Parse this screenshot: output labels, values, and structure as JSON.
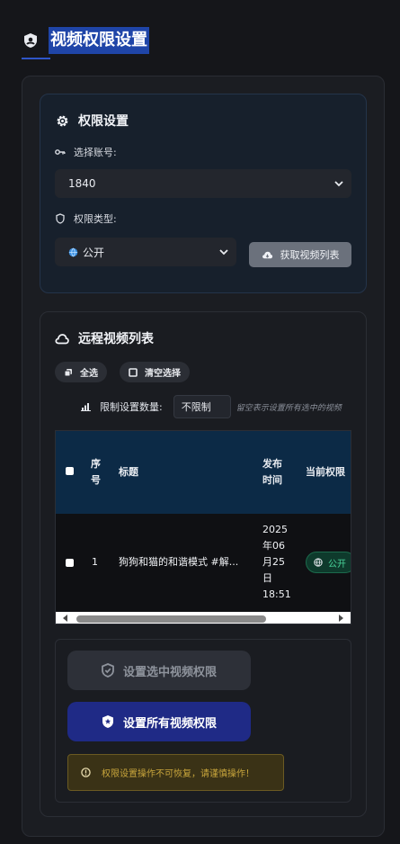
{
  "header": {
    "title": "视频权限设置",
    "icon": "shield-user-icon"
  },
  "settings": {
    "title": "权限设置",
    "account_label": "选择账号:",
    "account_value": "1840",
    "perm_type_label": "权限类型:",
    "perm_type_value": "公开",
    "fetch_button": "获取视频列表"
  },
  "video_list": {
    "title": "远程视频列表",
    "select_all": "全选",
    "clear_selection": "清空选择",
    "limit_label": "限制设置数量:",
    "limit_value": "不限制",
    "limit_hint": "留空表示设置所有选中的视频",
    "columns": [
      "序号",
      "标题",
      "发布时间",
      "当前权限"
    ],
    "columns_display": {
      "index": [
        "序",
        "号"
      ],
      "title": "标题",
      "time": [
        "发布",
        "时间"
      ],
      "perm": "当前权限"
    },
    "rows": [
      {
        "index": "1",
        "title": "狗狗和猫的和谐模式 #解...",
        "time_lines": [
          "2025",
          "年06",
          "月25",
          "日",
          "18:51"
        ],
        "permission": "公开"
      }
    ]
  },
  "actions": {
    "set_selected": "设置选中视频权限",
    "set_all": "设置所有视频权限",
    "warning": "权限设置操作不可恢复，请谨慎操作！"
  },
  "colors": {
    "accent": "#1f2a86",
    "title_highlight": "#1f45a8",
    "badge_green": "#49d49a",
    "warning_text": "#c9a63c"
  }
}
